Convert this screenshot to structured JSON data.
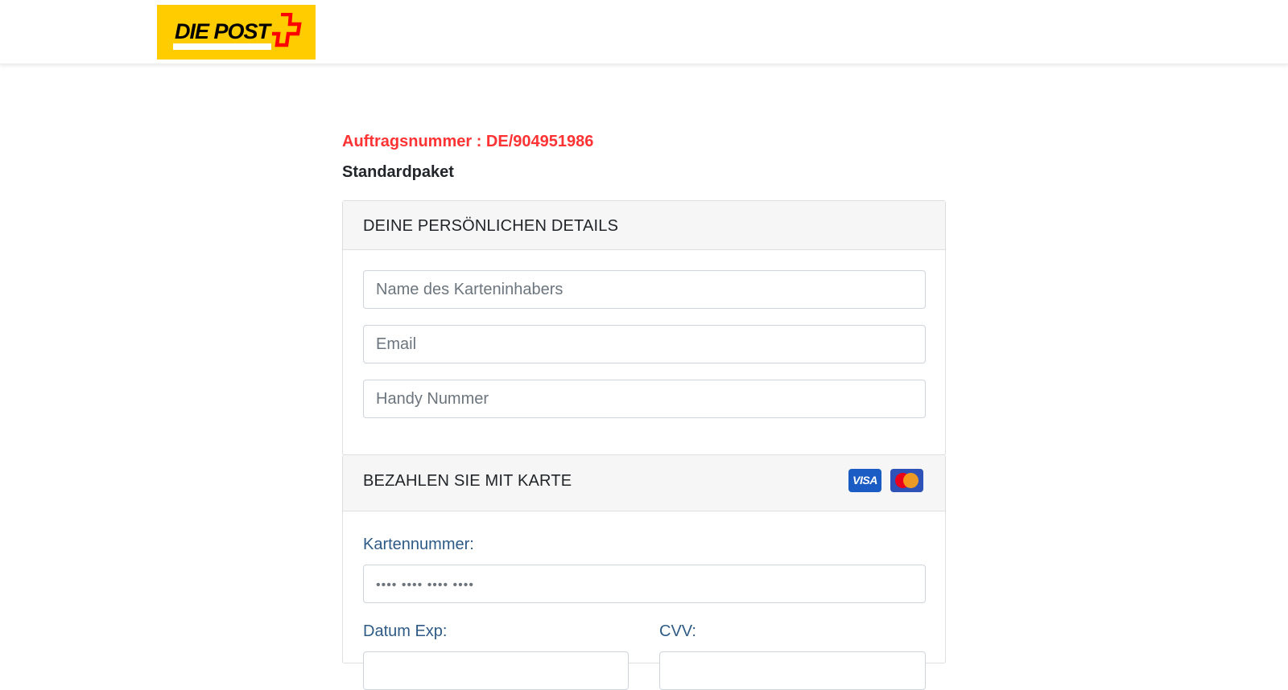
{
  "brand": {
    "logo_text": "DIE POST",
    "logo_color": "#ffcc00",
    "cross_color": "#ff0000"
  },
  "order": {
    "number_text": "Auftragsnummer : DE/904951986",
    "package": "Standardpaket"
  },
  "personal": {
    "title": "DEINE PERSÖNLICHEN DETAILS",
    "name_placeholder": "Name des Karteninhabers",
    "email_placeholder": "Email",
    "phone_placeholder": "Handy Nummer"
  },
  "payment": {
    "title": "BEZAHLEN SIE MIT KARTE",
    "card_icons": [
      "visa-icon",
      "mastercard-icon"
    ],
    "visa_text": "VISA",
    "card_number_label": "Kartennummer:",
    "card_number_placeholder": "•••• •••• •••• ••••",
    "exp_label": "Datum Exp:",
    "cvv_label": "CVV:"
  },
  "colors": {
    "order_number": "#ff3333",
    "field_label": "#2e5a86"
  }
}
